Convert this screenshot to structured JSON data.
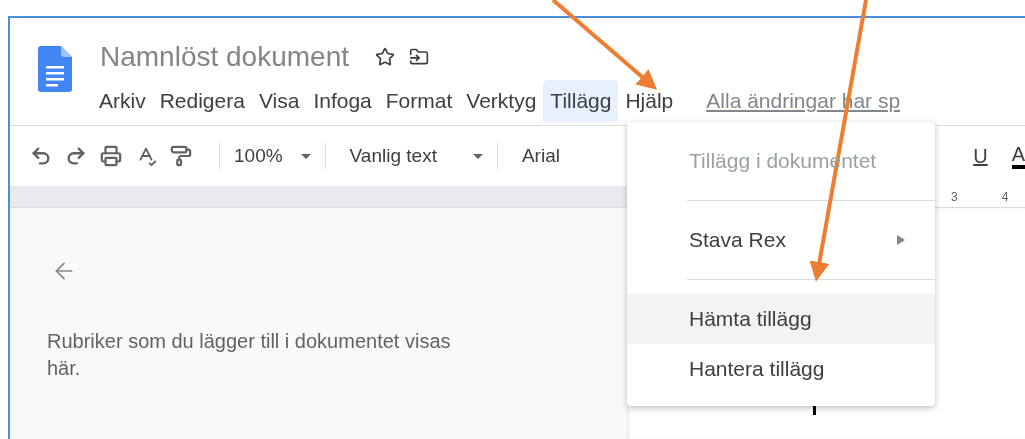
{
  "document": {
    "title": "Namnlöst dokument"
  },
  "menu_bar": {
    "items": [
      {
        "label": "Arkiv",
        "selected": false
      },
      {
        "label": "Redigera",
        "selected": false
      },
      {
        "label": "Visa",
        "selected": false
      },
      {
        "label": "Infoga",
        "selected": false
      },
      {
        "label": "Format",
        "selected": false
      },
      {
        "label": "Verktyg",
        "selected": false
      },
      {
        "label": "Tillägg",
        "selected": true
      },
      {
        "label": "Hjälp",
        "selected": false
      }
    ],
    "save_status": "Alla ändringar har sp"
  },
  "toolbar": {
    "zoom": "100%",
    "style": "Vanlig text",
    "font": "Arial",
    "underline": "U",
    "text_color": "A"
  },
  "ruler": {
    "labels": [
      "3",
      "4"
    ]
  },
  "outline_panel": {
    "empty_message": "Rubriker som du lägger till i dokumentet visas här."
  },
  "dropdown_menu": {
    "items": [
      {
        "kind": "item",
        "label": "Tillägg i dokumentet",
        "disabled": true,
        "selected": false
      },
      {
        "kind": "separator"
      },
      {
        "kind": "submenu",
        "label": "Stava Rex",
        "disabled": false,
        "selected": false
      },
      {
        "kind": "separator"
      },
      {
        "kind": "item",
        "label": "Hämta tillägg",
        "disabled": false,
        "selected": true
      },
      {
        "kind": "item",
        "label": "Hantera tillägg",
        "disabled": false,
        "selected": false
      }
    ]
  }
}
